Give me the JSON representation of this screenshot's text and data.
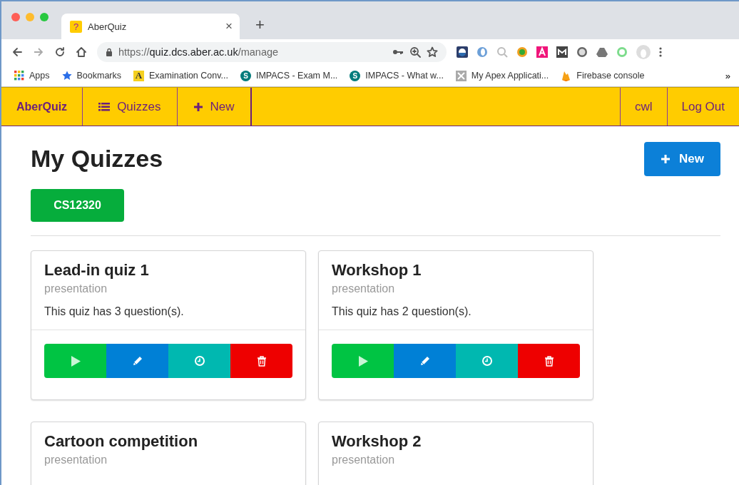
{
  "browser": {
    "tab": {
      "title": "AberQuiz",
      "favicon": "?",
      "close": "×",
      "selected": true
    },
    "new_tab": "+",
    "url": {
      "scheme": "https://",
      "host": "quiz.dcs.aber.ac.uk",
      "path": "/manage"
    },
    "bookmarks": [
      {
        "kind": "apps",
        "label": "Apps"
      },
      {
        "kind": "star",
        "label": "Bookmarks"
      },
      {
        "kind": "letter",
        "icon_letter": "A",
        "label": "Examination Conv..."
      },
      {
        "kind": "sharepoint",
        "icon_letter": "S",
        "label": "IMPACS - Exam M..."
      },
      {
        "kind": "sharepoint",
        "icon_letter": "S",
        "label": "IMPACS - What w..."
      },
      {
        "kind": "apex",
        "label": "My Apex Applicati..."
      },
      {
        "kind": "firebase",
        "label": "Firebase console"
      }
    ],
    "bookmarks_overflow": "»"
  },
  "navbar": {
    "brand": "AberQuiz",
    "items": [
      {
        "kind": "list",
        "label": "Quizzes"
      },
      {
        "kind": "plus",
        "label": "New"
      }
    ],
    "right_items": [
      {
        "label": "cwl"
      },
      {
        "label": "Log Out"
      }
    ]
  },
  "page": {
    "title": "My Quizzes",
    "new_button": "New",
    "module_tag": "CS12320"
  },
  "quizzes": [
    {
      "title": "Lead-in quiz 1",
      "type": "presentation",
      "description": "This quiz has 3 question(s).",
      "actions": [
        {
          "kind": "play",
          "color": "#00c443"
        },
        {
          "kind": "edit",
          "color": "#0080d6"
        },
        {
          "kind": "history",
          "color": "#00b8b0"
        },
        {
          "kind": "delete",
          "color": "#ee0000"
        }
      ]
    },
    {
      "title": "Workshop 1",
      "type": "presentation",
      "description": "This quiz has 2 question(s).",
      "actions": [
        {
          "kind": "play",
          "color": "#00c443"
        },
        {
          "kind": "edit",
          "color": "#0080d6"
        },
        {
          "kind": "history",
          "color": "#00b8b0"
        },
        {
          "kind": "delete",
          "color": "#ee0000"
        }
      ]
    },
    {
      "title": "Cartoon competition",
      "type": "presentation"
    },
    {
      "title": "Workshop 2",
      "type": "presentation"
    }
  ]
}
